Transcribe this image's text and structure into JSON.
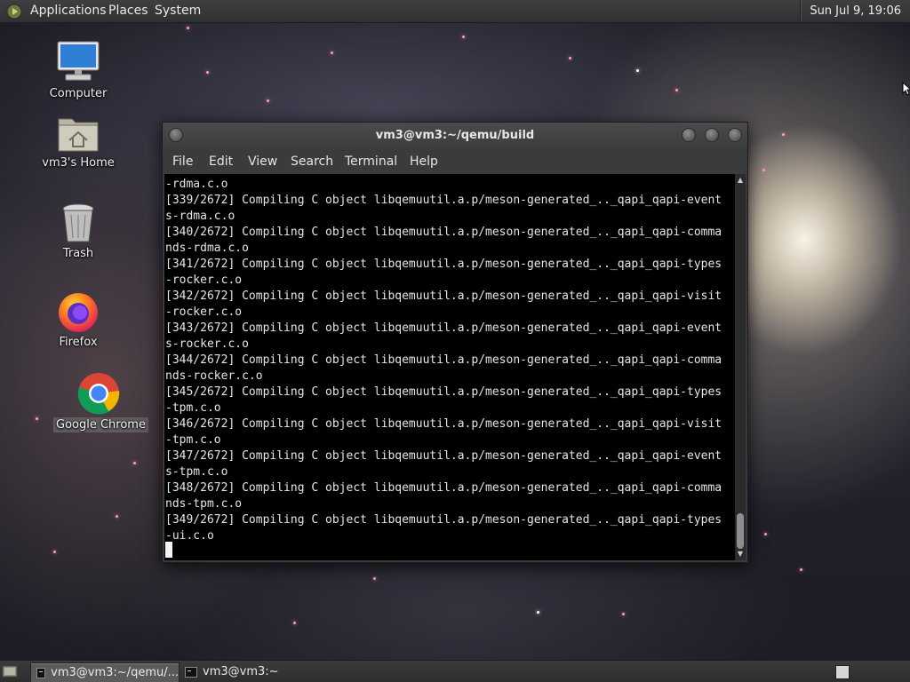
{
  "top_panel": {
    "menus": [
      "Applications",
      "Places",
      "System"
    ],
    "clock": "Sun Jul  9, 19:06"
  },
  "desktop_icons": [
    {
      "label": "Computer",
      "icon": "computer-icon"
    },
    {
      "label": "vm3's Home",
      "icon": "home-folder-icon"
    },
    {
      "label": "Trash",
      "icon": "trash-icon"
    },
    {
      "label": "Firefox",
      "icon": "firefox-icon"
    },
    {
      "label": "Google Chrome",
      "icon": "chrome-icon"
    }
  ],
  "terminal": {
    "title": "vm3@vm3:~/qemu/build",
    "menus": [
      "File",
      "Edit",
      "View",
      "Search",
      "Terminal",
      "Help"
    ],
    "lines": [
      "-rdma.c.o",
      "[339/2672] Compiling C object libqemuutil.a.p/meson-generated_.._qapi_qapi-event",
      "s-rdma.c.o",
      "[340/2672] Compiling C object libqemuutil.a.p/meson-generated_.._qapi_qapi-comma",
      "nds-rdma.c.o",
      "[341/2672] Compiling C object libqemuutil.a.p/meson-generated_.._qapi_qapi-types",
      "-rocker.c.o",
      "[342/2672] Compiling C object libqemuutil.a.p/meson-generated_.._qapi_qapi-visit",
      "-rocker.c.o",
      "[343/2672] Compiling C object libqemuutil.a.p/meson-generated_.._qapi_qapi-event",
      "s-rocker.c.o",
      "[344/2672] Compiling C object libqemuutil.a.p/meson-generated_.._qapi_qapi-comma",
      "nds-rocker.c.o",
      "[345/2672] Compiling C object libqemuutil.a.p/meson-generated_.._qapi_qapi-types",
      "-tpm.c.o",
      "[346/2672] Compiling C object libqemuutil.a.p/meson-generated_.._qapi_qapi-visit",
      "-tpm.c.o",
      "[347/2672] Compiling C object libqemuutil.a.p/meson-generated_.._qapi_qapi-event",
      "s-tpm.c.o",
      "[348/2672] Compiling C object libqemuutil.a.p/meson-generated_.._qapi_qapi-comma",
      "nds-tpm.c.o",
      "[349/2672] Compiling C object libqemuutil.a.p/meson-generated_.._qapi_qapi-types",
      "-ui.c.o"
    ]
  },
  "taskbar": {
    "items": [
      {
        "label": "vm3@vm3:~/qemu/...",
        "active": true
      },
      {
        "label": "vm3@vm3:~",
        "active": false
      }
    ]
  },
  "colors": {
    "panel": "#333436",
    "terminal_bg": "#000000",
    "terminal_fg": "#e5e5e5"
  }
}
